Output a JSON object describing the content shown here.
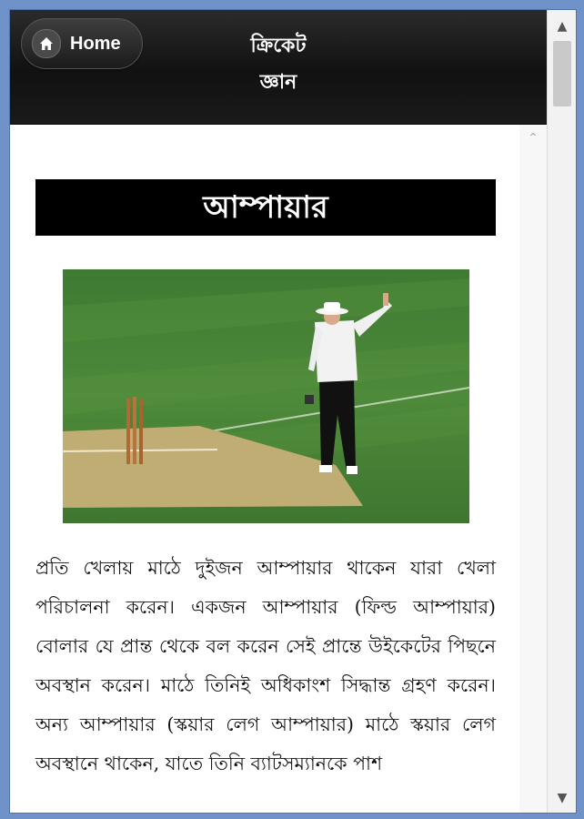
{
  "header": {
    "home_label": "Home",
    "title_line1": "ক্রিকেট",
    "title_line2": "জ্ঞান"
  },
  "article": {
    "heading": "আম্পায়ার",
    "photo_icon": "umpire-photo",
    "paragraph": "প্রতি খেলায় মাঠে দুইজন আম্পায়ার থাকেন যারা খেলা পরিচালনা করেন। একজন আম্পায়ার (ফিল্ড আম্পায়ার) বোলার যে প্রান্ত থেকে বল করেন সেই প্রান্তে উইকেটের পিছনে অবস্থান করেন। মাঠে তিনিই অধিকাংশ সিদ্ধান্ত গ্রহণ করেন। অন্য আম্পায়ার (স্কয়ার লেগ আম্পায়ার) মাঠে স্কয়ার লেগ অবস্থানে থাকেন, যাতে তিনি ব্যাটসম্যানকে পাশ"
  },
  "colors": {
    "header_bg": "#111111",
    "heading_bg": "#000000",
    "frame": "#6f93c9"
  }
}
